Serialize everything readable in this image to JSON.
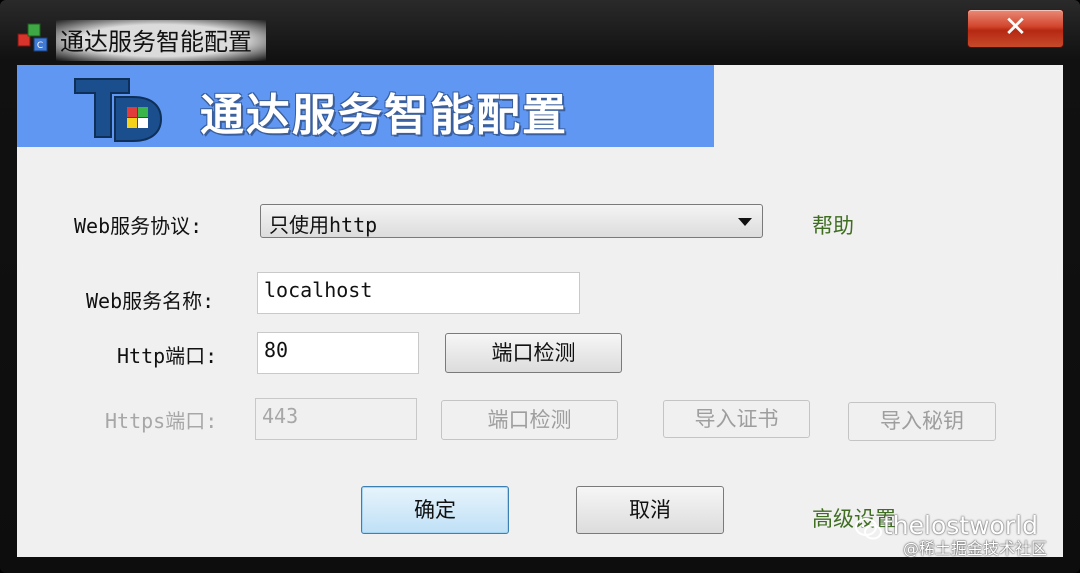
{
  "window": {
    "title": "通达服务智能配置",
    "close_label": "✕"
  },
  "banner": {
    "title": "通达服务智能配置"
  },
  "form": {
    "protocol_label": "Web服务协议:",
    "protocol_value": "只使用http",
    "help_link": "帮助",
    "service_name_label": "Web服务名称:",
    "service_name_value": "localhost",
    "http_port_label": "Http端口:",
    "http_port_value": "80",
    "http_check_button": "端口检测",
    "https_port_label": "Https端口:",
    "https_port_value": "443",
    "https_check_button": "端口检测",
    "import_cert_button": "导入证书",
    "import_key_button": "导入秘钥"
  },
  "footer": {
    "ok_button": "确定",
    "cancel_button": "取消",
    "advanced_link": "高级设置"
  },
  "watermark": {
    "handle": "thelostworld",
    "source": "@稀土掘金技术社区"
  },
  "colors": {
    "banner": "#5f97f3",
    "link": "#3f6e22",
    "close_button": "#c74a2a"
  }
}
